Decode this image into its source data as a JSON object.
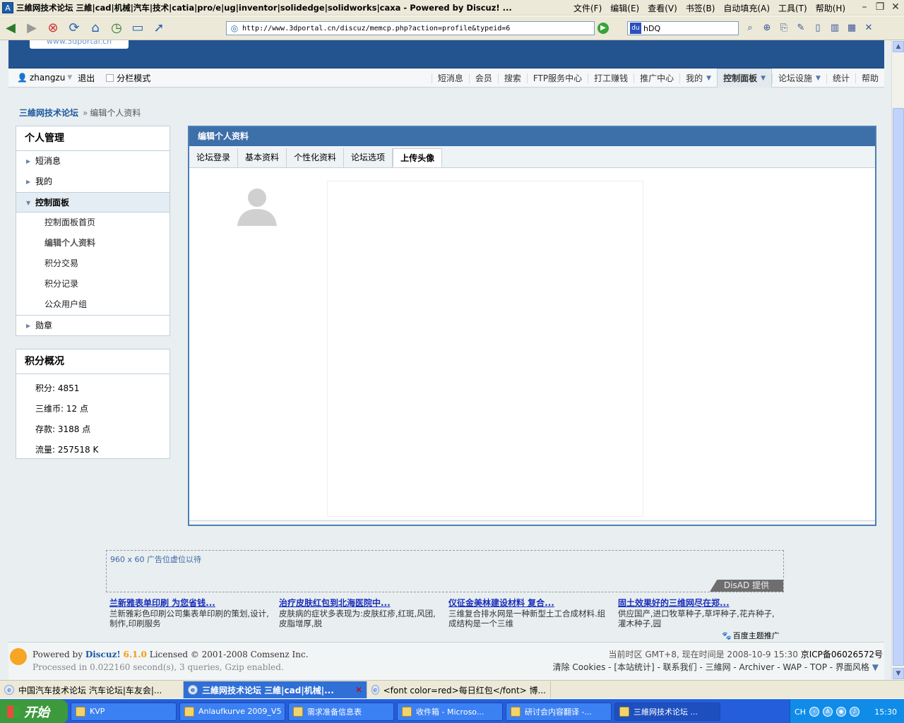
{
  "window": {
    "title": "三維网技术论坛 三維|cad|机械|汽车|技术|catia|pro/e|ug|inventor|solidedge|solidworks|caxa - Powered by Discuz! ...",
    "menus": [
      "文件(F)",
      "编辑(E)",
      "查看(V)",
      "书签(B)",
      "自动填充(A)",
      "工具(T)",
      "帮助(H)"
    ]
  },
  "address": {
    "url": "http://www.3dportal.cn/discuz/memcp.php?action=profile&typeid=6"
  },
  "search": {
    "value": "hDQ"
  },
  "site": {
    "logo_text": "www.3dportal.cn"
  },
  "navbar": {
    "username": "zhangzu",
    "logout": "退出",
    "split_mode": "分栏模式",
    "links": [
      "短消息",
      "会员",
      "搜索",
      "FTP服务中心",
      "打工赚钱",
      "推广中心",
      "我的",
      "控制面板",
      "论坛设施",
      "统计",
      "帮助"
    ],
    "active": "控制面板"
  },
  "breadcrumb": {
    "home": "三維网技术论坛",
    "sep": "»",
    "current": "编辑个人资料"
  },
  "sidebar": {
    "title": "个人管理",
    "items": [
      "短消息",
      "我的",
      "控制面板"
    ],
    "subitems": [
      "控制面板首页",
      "编辑个人资料",
      "积分交易",
      "积分记录",
      "公众用户组"
    ],
    "last": "勋章"
  },
  "credits": {
    "title": "积分概况",
    "rows": [
      "积分: 4851",
      "三维币: 12 点",
      "存款: 3188 点",
      "流量: 257518 K"
    ]
  },
  "main": {
    "title": "编辑个人资料",
    "tabs": [
      "论坛登录",
      "基本资料",
      "个性化资料",
      "论坛选项",
      "上传头像"
    ],
    "active_tab": "上传头像"
  },
  "ad": {
    "placeholder": "960 x 60 广告位虚位以待",
    "provider": "DisAD 提供",
    "links": [
      {
        "title": "兰新雅表单印刷 为您省钱...",
        "desc": "兰新雅彩色印刷公司集表单印刷的策划,设计,制作,印刷服务"
      },
      {
        "title": "治疗皮肤红包到北海医院中...",
        "desc": "皮肤病的症状多表现为:皮肤红疹,红斑,风团,皮脂增厚,脱"
      },
      {
        "title": "仪征金美林建设材料 复合...",
        "desc": "三维复合排水网是一种新型土工合成材料.组成结构是一个三维"
      },
      {
        "title": "固土效果好的三维网尽在郑...",
        "desc": "供应国产,进口牧草种子,草坪种子,花卉种子,灌木种子,园"
      }
    ],
    "baidu": "百度主题推广"
  },
  "footer": {
    "powered": "Powered by",
    "brand": "Discuz!",
    "version": "6.1.0",
    "license": "Licensed © 2001-2008 Comsenz Inc.",
    "processed": "Processed in 0.022160 second(s), 3 queries, Gzip enabled.",
    "timezone": "当前时区 GMT+8, 现在时间是 2008-10-9 15:30",
    "icp": "京ICP备06026572号",
    "links": "清除 Cookies - [本站统计] - 联系我们 - 三維网 - Archiver - WAP - TOP - 界面风格"
  },
  "browser_tabs": [
    {
      "label": "中国汽车技术论坛 汽车论坛|车友会|..."
    },
    {
      "label": "三維网技术论坛 三維|cad|机械|..."
    },
    {
      "label": "<font color=red>每日红包</font> 博..."
    }
  ],
  "taskbar": {
    "start": "开始",
    "tasks": [
      "KVP",
      "Anlaufkurve 2009_V5",
      "需求准备信息表",
      "收件箱 - Microso...",
      "研讨会内容翻译 -...",
      "三維网技术论坛 ..."
    ],
    "lang": "CH",
    "clock": "15:30"
  }
}
